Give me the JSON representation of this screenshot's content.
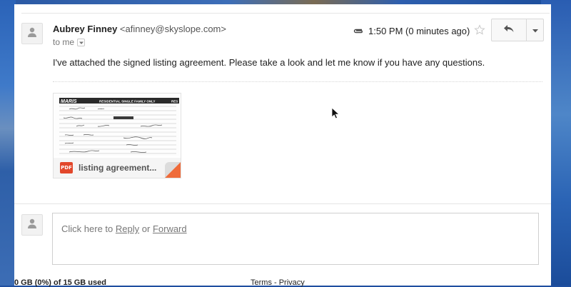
{
  "message": {
    "sender_name": "Aubrey Finney",
    "sender_email": "<afinney@skyslope.com>",
    "recipient": "to me",
    "time": "1:50 PM (0 minutes ago)",
    "body": "I've attached the signed listing agreement. Please take a look and let me know if you have any questions."
  },
  "attachment": {
    "type_label": "PDF",
    "name": "listing agreement...",
    "thumbnail_header": "MARIS",
    "thumbnail_subheader": "RESIDENTIAL SINGLE FAMILY ONLY",
    "thumbnail_code": "RES"
  },
  "reply": {
    "prefix": "Click here to",
    "reply_link": "Reply",
    "or": "or",
    "forward_link": "Forward"
  },
  "footer": {
    "storage": "0 GB (0%) of 15 GB used",
    "links": "Terms - Privacy"
  },
  "icons": {
    "avatar": "person-icon",
    "attachment": "paperclip-icon",
    "star": "star-icon",
    "reply": "reply-arrow-icon",
    "more": "chevron-down-icon"
  },
  "colors": {
    "pdf_red": "#e2472b",
    "corner_orange": "#ef6b3a"
  }
}
